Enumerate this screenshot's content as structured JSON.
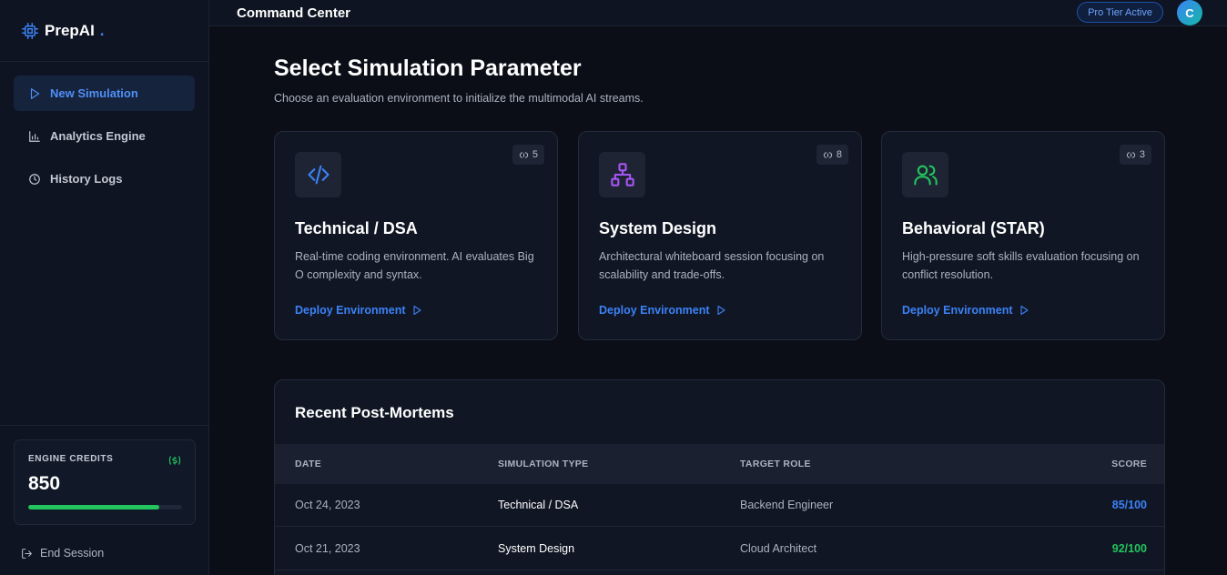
{
  "brand": {
    "name": "PrepAI",
    "dot": "."
  },
  "sidebar": {
    "items": [
      {
        "label": "New Simulation",
        "icon": "play-icon",
        "active": true
      },
      {
        "label": "Analytics Engine",
        "icon": "bar-chart-icon",
        "active": false
      },
      {
        "label": "History Logs",
        "icon": "clock-icon",
        "active": false
      }
    ],
    "credits": {
      "label": "ENGINE CREDITS",
      "value": "850",
      "fill_fraction": 0.85,
      "icon": "currency-icon"
    },
    "end_session": "End Session"
  },
  "header": {
    "title": "Command Center",
    "badge": "Pro Tier Active",
    "avatar_initial": "C"
  },
  "main": {
    "heading": "Select Simulation Parameter",
    "subheading": "Choose an evaluation environment to initialize the multimodal AI streams.",
    "cards": [
      {
        "title": "Technical / DSA",
        "description": "Real-time coding environment. AI evaluates Big O complexity and syntax.",
        "count": "5",
        "icon": "code-icon",
        "icon_color": "#3b82f6",
        "action": "Deploy Environment"
      },
      {
        "title": "System Design",
        "description": "Architectural whiteboard session focusing on scalability and trade-offs.",
        "count": "8",
        "icon": "network-icon",
        "icon_color": "#a855f7",
        "action": "Deploy Environment"
      },
      {
        "title": "Behavioral (STAR)",
        "description": "High-pressure soft skills evaluation focusing on conflict resolution.",
        "count": "3",
        "icon": "users-icon",
        "icon_color": "#22c55e",
        "action": "Deploy Environment"
      }
    ],
    "recent": {
      "title": "Recent Post-Mortems",
      "columns": [
        "DATE",
        "SIMULATION TYPE",
        "TARGET ROLE",
        "SCORE"
      ],
      "rows": [
        {
          "date": "Oct 24, 2023",
          "type": "Technical / DSA",
          "role": "Backend Engineer",
          "score": "85/100",
          "score_color": "#3b82f6"
        },
        {
          "date": "Oct 21, 2023",
          "type": "System Design",
          "role": "Cloud Architect",
          "score": "92/100",
          "score_color": "#22c55e"
        }
      ]
    }
  }
}
